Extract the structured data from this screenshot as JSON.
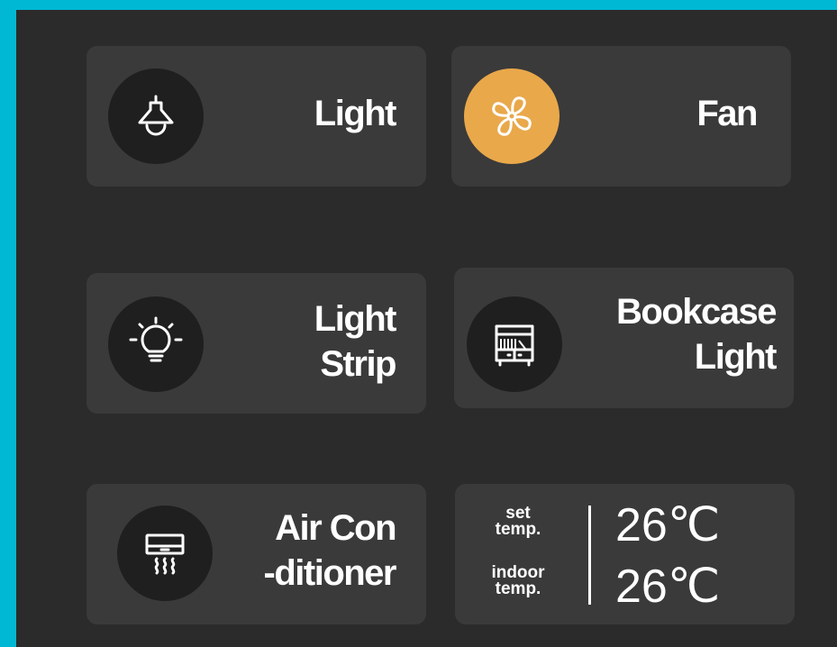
{
  "colors": {
    "background": "#00b8d4",
    "panel": "#2b2b2b",
    "card": "#3a3a3a",
    "icon_circle": "#1f1f1f",
    "active": "#e9a84a"
  },
  "tiles": {
    "light": {
      "line1": "Light",
      "icon": "ceiling-lamp-icon",
      "active": false
    },
    "fan": {
      "line1": "Fan",
      "icon": "fan-icon",
      "active": true
    },
    "light_strip": {
      "line1": "Light",
      "line2": "Strip",
      "icon": "bulb-icon",
      "active": false
    },
    "bookcase_light": {
      "line1": "Bookcase",
      "line2": "Light",
      "icon": "bookcase-icon",
      "active": false
    },
    "air_conditioner": {
      "line1": "Air Con",
      "line2": "-ditioner",
      "icon": "air-conditioner-icon",
      "active": false
    }
  },
  "climate": {
    "set_label_1": "set",
    "set_label_2": "temp.",
    "indoor_label_1": "indoor",
    "indoor_label_2": "temp.",
    "set_value": "26℃",
    "indoor_value": "26℃"
  }
}
